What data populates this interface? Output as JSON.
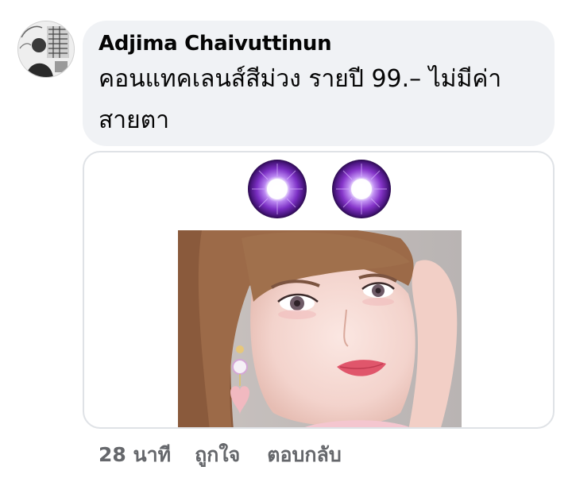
{
  "comment": {
    "author": "Adjima Chaivuttinun",
    "text": "คอนแทคเลนส์สีม่วง รายปี 99.– ไม่มีค่าสายตา",
    "timestamp": "28 นาที",
    "like_label": "ถูกใจ",
    "reply_label": "ตอบกลับ"
  },
  "colors": {
    "bubble_bg": "#f0f2f5",
    "text": "#050505",
    "meta_text": "#65676b",
    "lens_purple": "#7a2fb5"
  },
  "icons": {
    "avatar": "profile-avatar",
    "lens": "purple-contact-lens"
  }
}
